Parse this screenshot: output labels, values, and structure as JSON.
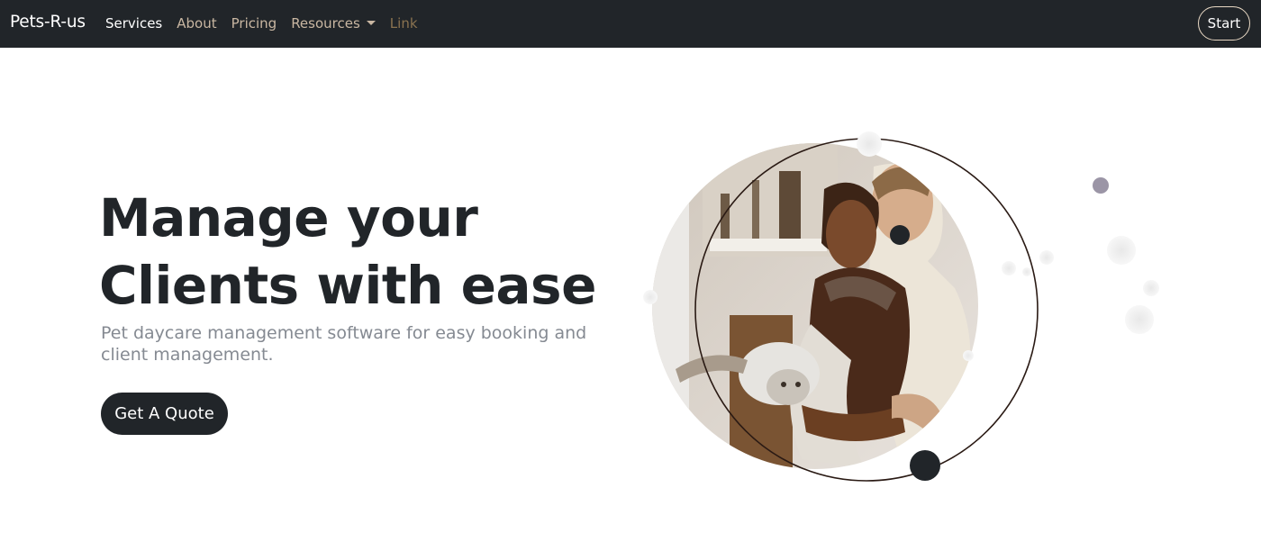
{
  "navbar": {
    "brand": "Pets-R-us",
    "links": [
      {
        "label": "Services"
      },
      {
        "label": "About"
      },
      {
        "label": "Pricing"
      },
      {
        "label": "Resources"
      },
      {
        "label": "Link"
      }
    ],
    "start_label": "Start"
  },
  "hero": {
    "title_line1": "Manage your",
    "title_line2": "Clients with ease",
    "subtitle": "Pet daycare management software for easy booking and client management.",
    "cta_label": "Get A Quote"
  },
  "colors": {
    "navbar_bg": "#212529",
    "accent_dark": "#212529",
    "muted_link": "#c9b7a2",
    "disabled_link": "#8a7350",
    "subtitle": "#858a92"
  },
  "illustration": {
    "icon": "couple-with-cat-photo"
  }
}
